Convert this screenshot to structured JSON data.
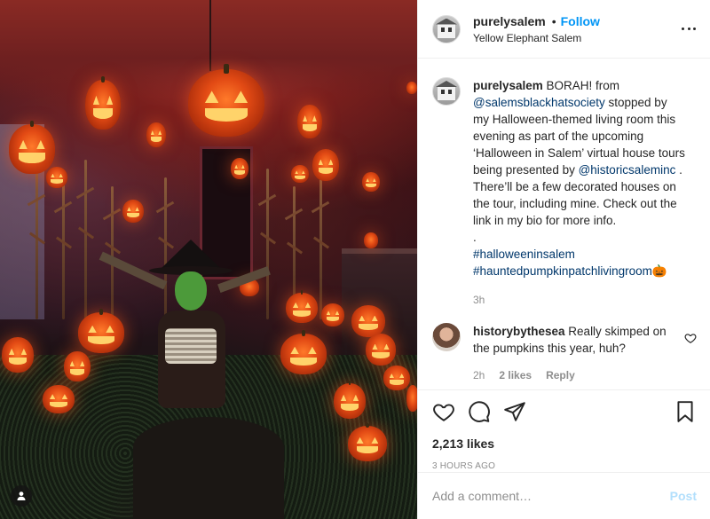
{
  "post": {
    "username": "purelysalem",
    "dot": "•",
    "follow_label": "Follow",
    "location": "Yellow Elephant Salem"
  },
  "caption": {
    "username": "purelysalem",
    "text_1": " BORAH! from ",
    "mention_1": "@salemsblackhatsociety",
    "text_2": " stopped by my Halloween-themed living room this evening as part of the upcoming ‘Halloween in Salem’ virtual house tours being presented by ",
    "mention_2": "@historicsaleminc",
    "text_3": " . There’ll be a few decorated houses on the tour, including mine. Check out the link in my bio for more info.",
    "separator": ".",
    "hashtag_1": "#halloweeninsalem",
    "hashtag_2": "#hauntedpumpkinpatchlivingroom🎃",
    "time": "3h"
  },
  "reply": {
    "username": "historybythesea",
    "text": " Really skimped on the pumpkins this year, huh?",
    "time": "2h",
    "likes": "2 likes",
    "reply_label": "Reply"
  },
  "stats": {
    "likes": "2,213 likes",
    "posted": "3 HOURS AGO"
  },
  "composer": {
    "placeholder": "Add a comment…",
    "post_label": "Post"
  },
  "icons": {
    "more": "more-options-icon",
    "heart": "heart-icon",
    "comment": "comment-icon",
    "share": "share-icon",
    "bookmark": "bookmark-icon",
    "user_tag": "user-tag-icon"
  },
  "colors": {
    "link": "#0095f6",
    "mention": "#00376b",
    "muted": "#8e8e8e",
    "post_disabled": "#b2dffc"
  }
}
